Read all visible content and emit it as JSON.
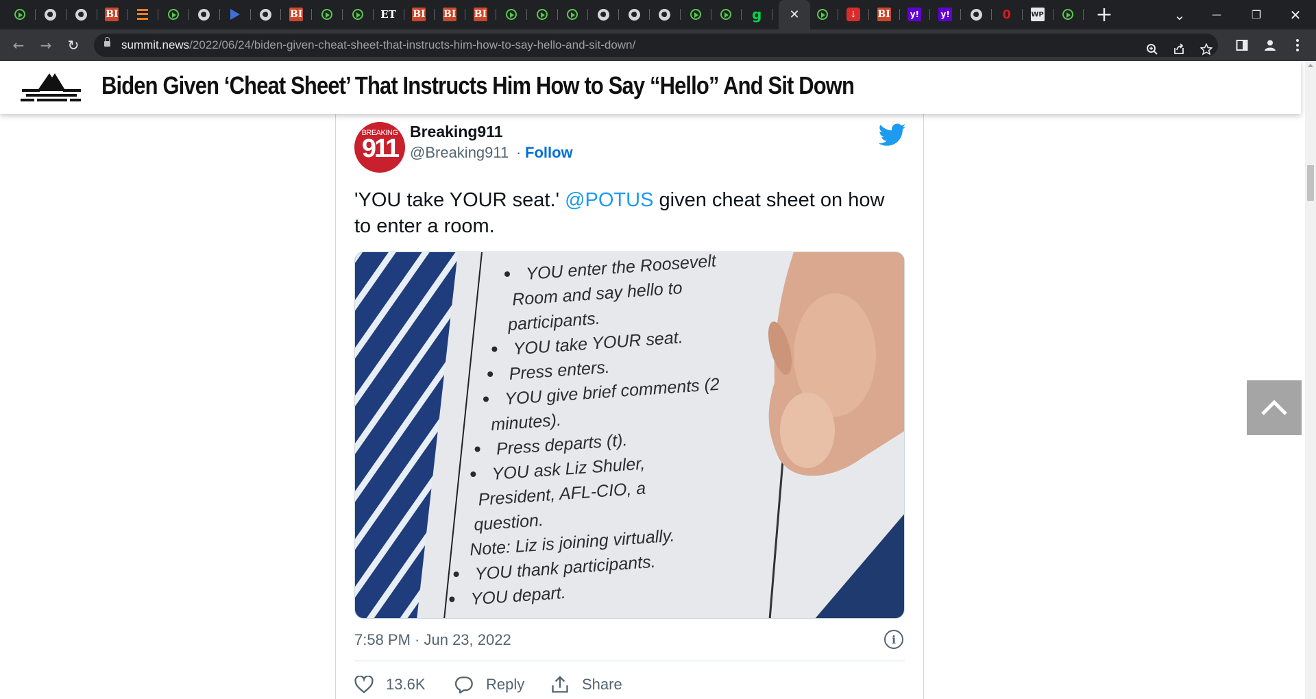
{
  "browser": {
    "tabs": [
      {
        "favicon": "play-icon"
      },
      {
        "favicon": "globe-icon"
      },
      {
        "favicon": "globe-icon"
      },
      {
        "favicon": "bi-icon",
        "glyph": "BI"
      },
      {
        "favicon": "bars-icon"
      },
      {
        "favicon": "play-icon"
      },
      {
        "favicon": "globe-icon"
      },
      {
        "favicon": "arrow-icon"
      },
      {
        "favicon": "globe-icon"
      },
      {
        "favicon": "bi-icon",
        "glyph": "BI"
      },
      {
        "favicon": "play-icon"
      },
      {
        "favicon": "play-icon"
      },
      {
        "favicon": "et-icon",
        "glyph": "ET"
      },
      {
        "favicon": "bi-icon",
        "glyph": "BI"
      },
      {
        "favicon": "bi-icon",
        "glyph": "BI"
      },
      {
        "favicon": "bi-icon",
        "glyph": "BI"
      },
      {
        "favicon": "play-icon"
      },
      {
        "favicon": "play-icon"
      },
      {
        "favicon": "play-icon"
      },
      {
        "favicon": "globe-icon"
      },
      {
        "favicon": "globe-icon"
      },
      {
        "favicon": "globe-icon"
      },
      {
        "favicon": "play-icon"
      },
      {
        "favicon": "play-icon"
      },
      {
        "favicon": "g-icon",
        "glyph": "g"
      }
    ],
    "tabs_after_active": [
      {
        "favicon": "play-icon"
      },
      {
        "favicon": "gift-icon",
        "glyph": "⇣"
      },
      {
        "favicon": "bi-icon",
        "glyph": "BI"
      },
      {
        "favicon": "yahoo-icon",
        "glyph": "y!"
      },
      {
        "favicon": "yahoo-icon",
        "glyph": "y!"
      },
      {
        "favicon": "globe-icon"
      },
      {
        "favicon": "zero-icon",
        "glyph": "0"
      },
      {
        "favicon": "wp-icon",
        "glyph": "WP"
      },
      {
        "favicon": "play-icon"
      }
    ],
    "active_tab_close": "✕",
    "new_tab": "+",
    "tab_search": "⌄",
    "window_minimize": "—",
    "window_restore": "❐",
    "window_close": "✕",
    "nav": {
      "back": "←",
      "forward": "→",
      "reload": "↻"
    },
    "url_domain": "summit.news",
    "url_path": "/2022/06/24/biden-given-cheat-sheet-that-instructs-him-how-to-say-hello-and-sit-down/",
    "toolbar_icons": [
      "zoom-icon",
      "share-icon",
      "star-icon",
      "sidebar-icon",
      "profile-icon",
      "menu-icon"
    ]
  },
  "site": {
    "headline": "Biden Given ‘Cheat Sheet’ That Instructs Him How to Say “Hello” And Sit Down"
  },
  "tweet": {
    "avatar_top": "BREAKING",
    "avatar_num": "911",
    "author_name": "Breaking911",
    "author_handle": "@Breaking911",
    "separator": "·",
    "follow_label": "Follow",
    "text_before": "'YOU take YOUR seat.' ",
    "mention": "@POTUS",
    "text_after": " given cheat sheet on how to enter a room.",
    "media_lines": [
      "YOU enter the Roosevelt",
      "Room and say hello to",
      "participants.",
      "YOU take YOUR seat.",
      "Press enters.",
      "YOU give brief comments (2",
      "minutes).",
      "Press departs (t).",
      "YOU ask Liz Shuler,",
      "President, AFL-CIO, a",
      "question.",
      "Note: Liz is joining virtually.",
      "YOU thank participants.",
      "YOU depart."
    ],
    "timestamp": "7:58 PM · Jun 23, 2022",
    "info": "i",
    "likes": "13.6K",
    "reply_label": "Reply",
    "share_label": "Share"
  },
  "colors": {
    "chrome_dark": "#202124",
    "chrome_toolbar": "#35363a",
    "twitter_blue": "#1d9bf0",
    "follow_blue": "#006fd6",
    "muted_text": "#536471",
    "avatar_red": "#c8202d"
  }
}
